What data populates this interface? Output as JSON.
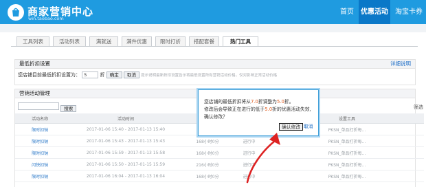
{
  "header": {
    "brand_title": "商家营销中心",
    "brand_sub": "win.taobao.com",
    "nav": [
      "首页",
      "优惠活动",
      "淘宝卡券"
    ]
  },
  "tabs": [
    "工具列表",
    "活动列表",
    "满就送",
    "满件优惠",
    "限时打折",
    "搭配套餐",
    "热门工具"
  ],
  "min_discount": {
    "title": "最低折扣设置",
    "detail_link": "详细说明",
    "prefix": "您店铺目前最低折扣设置为：",
    "value": "5",
    "unit": "折",
    "confirm": "确定",
    "cancel": "取消",
    "hint": "提示说明最新折扣设置告示将最低设置所有营销活动价格，仅对影响正常活动价格"
  },
  "manage": {
    "title": "营销活动管理",
    "search_btn": "搜索",
    "filter": "筛选",
    "columns": [
      "活动名称",
      "活动时间",
      "",
      "",
      "设置工具"
    ],
    "rows": [
      {
        "name": "限时扣钠",
        "time": "2017-01-06 15:40 - 2017-01-13 15:40",
        "remain": "",
        "status": "",
        "tool": "PKSN_单品打折每..."
      },
      {
        "name": "限时扣钠",
        "time": "2017-01-06 15:43 - 2017-01-13 15:43",
        "remain": "168小时0分",
        "status": "进行中",
        "tool": "PKSN_单品打折每..."
      },
      {
        "name": "限时扣钠",
        "time": "2017-01-06 15:59 - 2017-01-13 15:58",
        "remain": "168小时0分",
        "status": "进行中",
        "tool": "PKSN_单品打折每..."
      },
      {
        "name": "闪快扣钠",
        "time": "2017-01-06 15:50 - 2017-01-15 15:59",
        "remain": "216小时0分",
        "status": "进行中",
        "tool": "PKSN_单品打折每..."
      },
      {
        "name": "限时扣钠",
        "time": "2017-01-06 16:04 - 2017-01-13 16:04",
        "remain": "168小时0分",
        "status": "进行中",
        "tool": "PKSN_单品打折每..."
      }
    ]
  },
  "popup": {
    "l1a": "您店铺的最低折扣将从",
    "from": "7.0",
    "l1b": "折调整为",
    "to": "5.0",
    "l1c": "折。",
    "l2a": "修改后会导致正在进行的低于",
    "l2v": "5.0",
    "l2b": "折的优惠活动失效,",
    "l3": "确认修改？",
    "confirm": "确认修改",
    "cancel": "取消"
  },
  "colors": {
    "brand": "#1f9be0",
    "nav_active": "#0a78c8",
    "accent_orange": "#e05a1c"
  }
}
